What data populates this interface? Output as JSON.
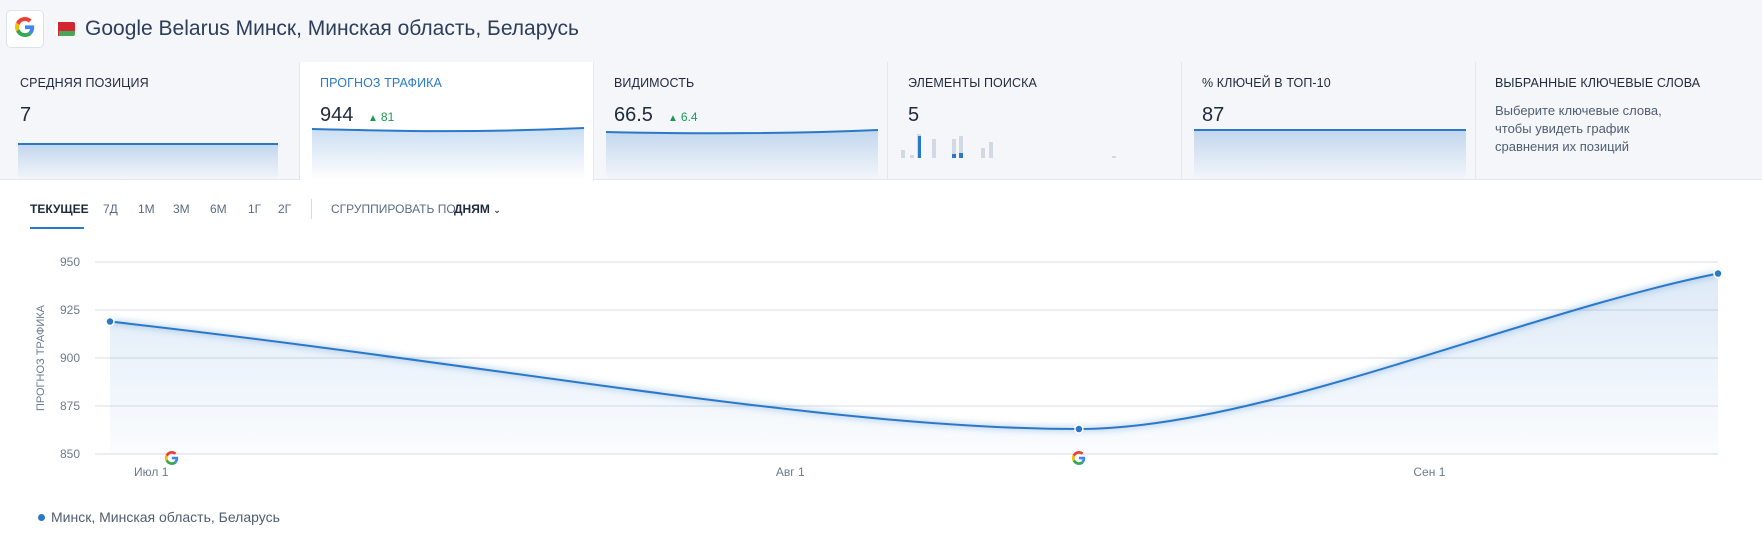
{
  "header": {
    "engine_icon": "google-icon",
    "flag_icon": "belarus-flag-icon",
    "title": "Google Belarus Минск, Минская область, Беларусь"
  },
  "cards": [
    {
      "label": "СРЕДНЯЯ ПОЗИЦИЯ",
      "value": "7",
      "delta": ""
    },
    {
      "label": "ПРОГНОЗ ТРАФИКА",
      "value": "944",
      "delta": "81",
      "active": true
    },
    {
      "label": "ВИДИМОСТЬ",
      "value": "66.5",
      "delta": "6.4"
    },
    {
      "label": "ЭЛЕМЕНТЫ ПОИСКА",
      "value": "5",
      "delta": ""
    },
    {
      "label": "% КЛЮЧЕЙ В ТОП-10",
      "value": "87",
      "delta": ""
    },
    {
      "label": "ВЫБРАННЫЕ КЛЮЧЕВЫЕ СЛОВА",
      "description": "Выберите ключевые слова, чтобы увидеть график сравнения их позиций"
    }
  ],
  "toolbar": {
    "tabs": [
      "ТЕКУЩЕЕ",
      "7Д",
      "1М",
      "3М",
      "6М",
      "1Г",
      "2Г"
    ],
    "active_tab": "ТЕКУЩЕЕ",
    "group_by_label": "СГРУППИРОВАТЬ ПО:",
    "group_by_value": "ДНЯМ"
  },
  "colors": {
    "accent": "#2a79c9",
    "positive": "#1c9a52",
    "text": "#1e2a3b",
    "muted": "#5a6b80"
  },
  "chart_data": {
    "type": "area",
    "ylabel": "ПРОГНОЗ ТРАФИКА",
    "ylim": [
      850,
      950
    ],
    "yticks": [
      950,
      925,
      900,
      875,
      850
    ],
    "xticks": [
      "Июл 1",
      "Авг 1",
      "Сен 1"
    ],
    "x_range": [
      "2024-06-29",
      "2024-09-15"
    ],
    "grid": true,
    "series": [
      {
        "name": "Минск, Минская область, Беларусь",
        "x": [
          "2024-06-29",
          "2024-08-15",
          "2024-09-15"
        ],
        "values": [
          919,
          863,
          944
        ]
      }
    ],
    "annotations": [
      {
        "x": "2024-07-02",
        "icon": "google-icon"
      },
      {
        "x": "2024-08-15",
        "icon": "google-icon"
      }
    ]
  }
}
